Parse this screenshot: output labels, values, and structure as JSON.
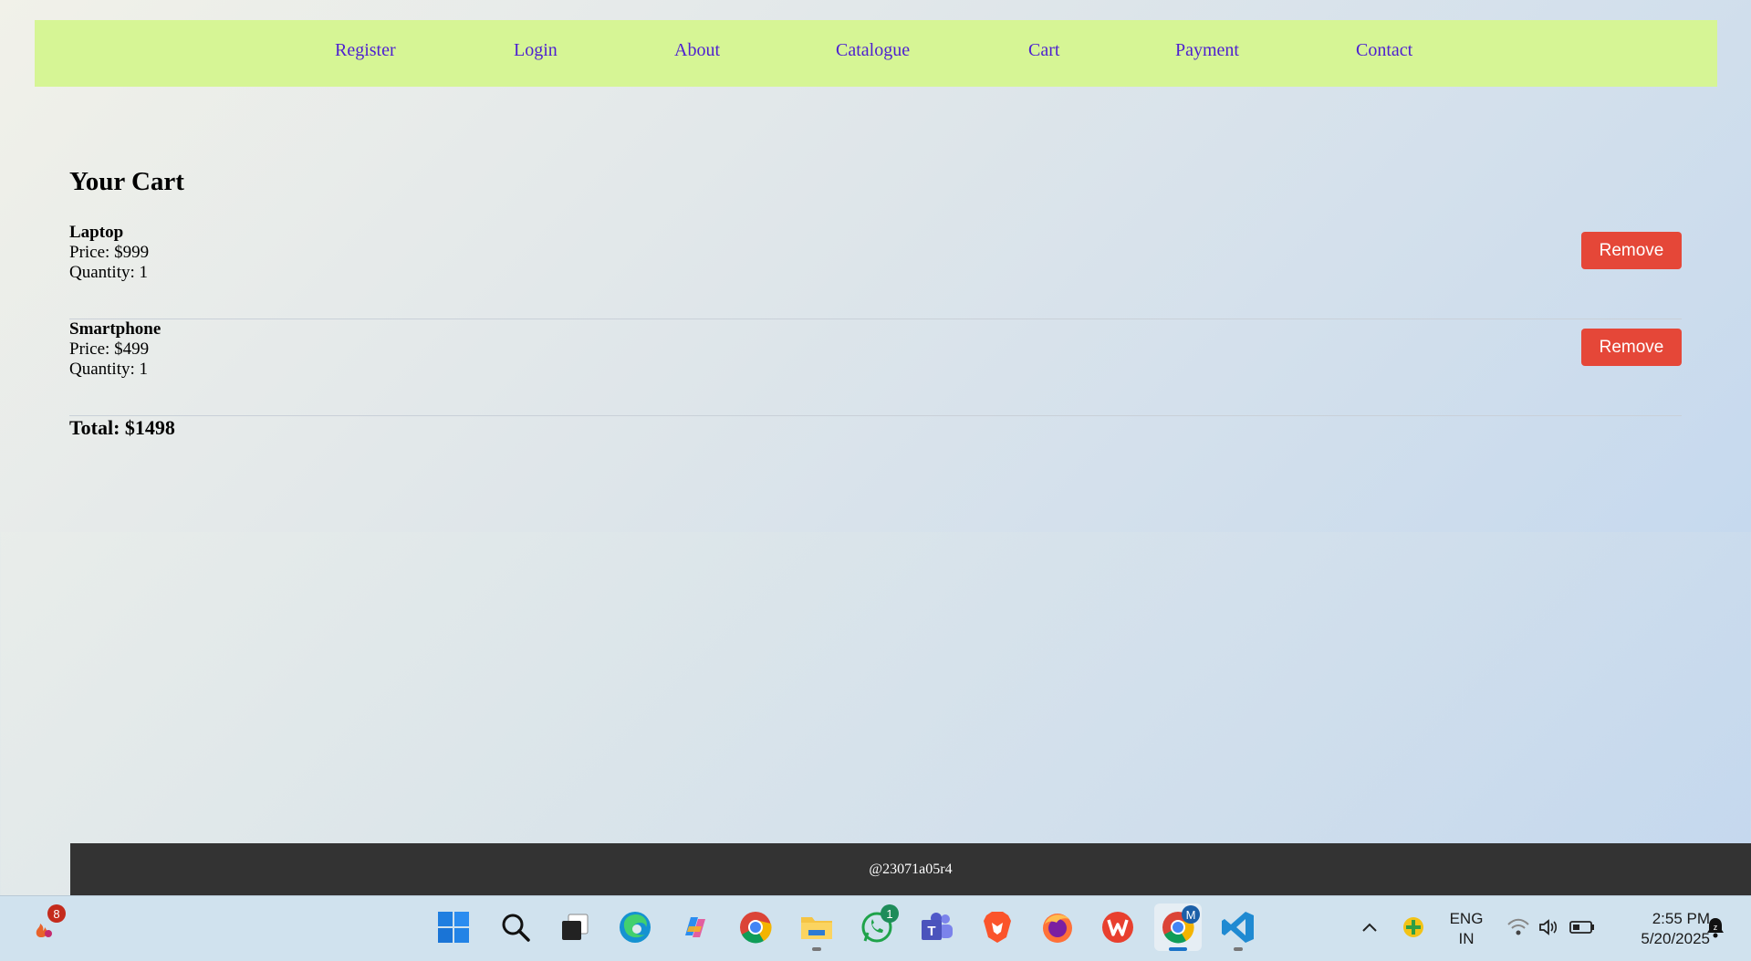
{
  "nav": {
    "links": [
      "Register",
      "Login",
      "About",
      "Catalogue",
      "Cart",
      "Payment",
      "Contact"
    ]
  },
  "cart": {
    "title": "Your Cart",
    "items": [
      {
        "name": "Laptop",
        "price": "Price: $999",
        "quantity": "Quantity: 1",
        "remove_label": "Remove"
      },
      {
        "name": "Smartphone",
        "price": "Price: $499",
        "quantity": "Quantity: 1",
        "remove_label": "Remove"
      }
    ],
    "total": "Total: $1498"
  },
  "footer": {
    "text": "@23071a05r4"
  },
  "taskbar": {
    "widget_badge": "8",
    "whatsapp_badge": "1",
    "chrome_profile_badge": "M",
    "language": "ENG",
    "region": "IN",
    "time": "2:55 PM",
    "date": "5/20/2025",
    "apps": [
      "start",
      "search",
      "task-view",
      "edge",
      "copilot",
      "chrome",
      "file-explorer",
      "whatsapp",
      "teams",
      "brave",
      "firefox",
      "wps-office",
      "chrome-active",
      "vscode"
    ]
  },
  "colors": {
    "nav_bg": "#d6f595",
    "nav_link": "#4d1fd1",
    "remove_button": "#e54738",
    "footer_bg": "#333333"
  }
}
